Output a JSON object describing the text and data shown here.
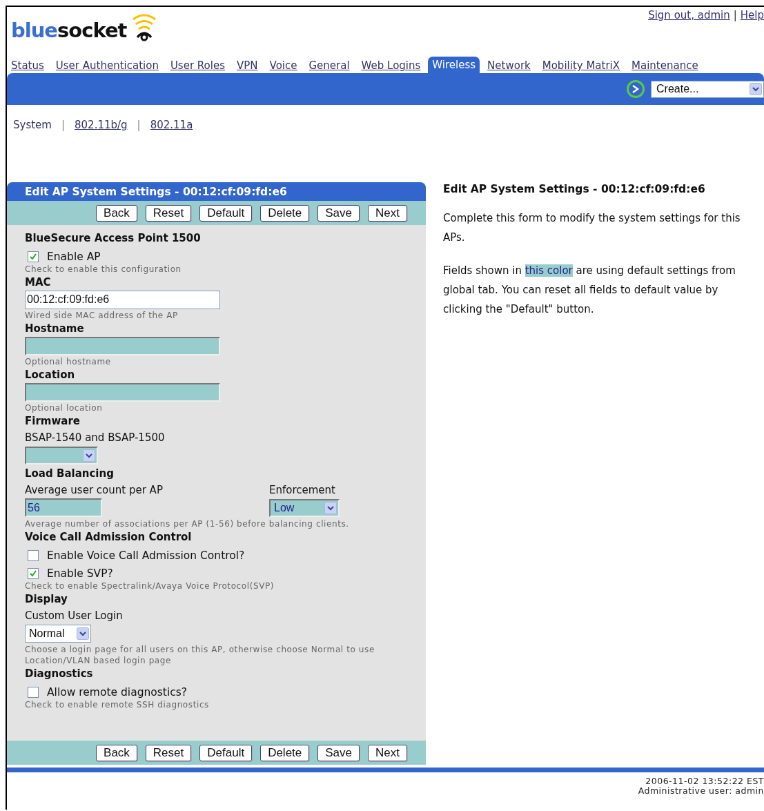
{
  "logo": {
    "part_1": "blue",
    "part_2": "socket"
  },
  "top_links": [
    {
      "label": "Sign out, admin"
    },
    {
      "separator": "|",
      "label": "Help"
    }
  ],
  "tabs": [
    {
      "label": "Status",
      "selected": false
    },
    {
      "label": "User Authentication",
      "selected": false
    },
    {
      "label": "User Roles",
      "selected": false
    },
    {
      "label": "VPN",
      "selected": false
    },
    {
      "label": "Voice",
      "selected": false
    },
    {
      "label": "General",
      "selected": false
    },
    {
      "label": "Web Logins",
      "selected": false
    },
    {
      "label": "Wireless",
      "selected": true
    },
    {
      "label": "Network",
      "selected": false
    },
    {
      "label": "Mobility MatriX",
      "selected": false
    },
    {
      "label": "Maintenance",
      "selected": false
    }
  ],
  "create_select": {
    "value": "Create..."
  },
  "subnav": [
    {
      "label": "System",
      "selected": true
    },
    {
      "separator": "|",
      "label": "802.11b/g",
      "selected": false
    },
    {
      "separator": "|",
      "label": "802.11a",
      "selected": false
    }
  ],
  "panel": {
    "title": "Edit AP System Settings - 00:12:cf:09:fd:e6",
    "buttons_top": [
      "Back",
      "Reset",
      "Default",
      "Delete",
      "Save",
      "Next"
    ],
    "buttons_bottom": [
      "Back",
      "Reset",
      "Default",
      "Delete",
      "Save",
      "Next"
    ],
    "items": [
      {
        "kind": "heading",
        "text": "BlueSecure Access Point 1500"
      },
      {
        "kind": "checkbox",
        "label": "Enable AP",
        "checked": true
      },
      {
        "kind": "hint",
        "text": "Check to enable this configuration"
      },
      {
        "kind": "heading",
        "text": "MAC"
      },
      {
        "kind": "input",
        "value": "00:12:cf:09:fd:e6",
        "default": false
      },
      {
        "kind": "hint",
        "text": "Wired side MAC address of the AP"
      },
      {
        "kind": "heading",
        "text": "Hostname"
      },
      {
        "kind": "input",
        "default": true
      },
      {
        "kind": "hint",
        "text": "Optional hostname"
      },
      {
        "kind": "heading",
        "text": "Location"
      },
      {
        "kind": "input",
        "default": true
      },
      {
        "kind": "hint",
        "text": "Optional location"
      },
      {
        "kind": "heading",
        "text": "Firmware"
      },
      {
        "kind": "label",
        "text": "BSAP-1540 and BSAP-1500"
      },
      {
        "kind": "select",
        "default": true
      },
      {
        "kind": "heading",
        "text": "Load Balancing"
      },
      {
        "kind": "pair",
        "left": {
          "label": "Average user count per AP",
          "value": "56",
          "default": true
        },
        "right": {
          "label": "Enforcement",
          "value": "Low",
          "default": true
        }
      },
      {
        "kind": "hint",
        "text": "Average number of associations per AP (1-56) before balancing clients."
      },
      {
        "kind": "heading",
        "text": "Voice Call Admission Control"
      },
      {
        "kind": "checkbox",
        "label": "Enable Voice Call Admission Control?",
        "checked": false
      },
      {
        "kind": "checkbox",
        "label": "Enable SVP?",
        "checked": true
      },
      {
        "kind": "hint",
        "text": "Check to enable Spectralink/Avaya Voice Protocol(SVP)"
      },
      {
        "kind": "heading",
        "text": "Display"
      },
      {
        "kind": "label",
        "text": "Custom User Login"
      },
      {
        "kind": "select",
        "value": "Normal",
        "default": false
      },
      {
        "kind": "hint",
        "text": "Choose a login page for all users on this AP, otherwise choose Normal to use Location/VLAN based login page"
      },
      {
        "kind": "heading",
        "text": "Diagnostics"
      },
      {
        "kind": "checkbox",
        "label": "Allow remote diagnostics?",
        "checked": false
      },
      {
        "kind": "hint",
        "text": "Check to enable remote SSH diagnostics"
      }
    ]
  },
  "help": {
    "title": "Edit AP System Settings - 00:12:cf:09:fd:e6",
    "paragraphs": [
      {
        "text": "Complete this form to modify the system settings for this APs."
      },
      {
        "before": "Fields shown in",
        "highlight": "this color",
        "after": "are using default settings from global tab. You can reset all fields to default value by clicking the \"Default\" button."
      }
    ]
  },
  "footer": {
    "timestamp": "2006-11-02 13:52:22 EST",
    "user": "Administrative user: admin"
  }
}
